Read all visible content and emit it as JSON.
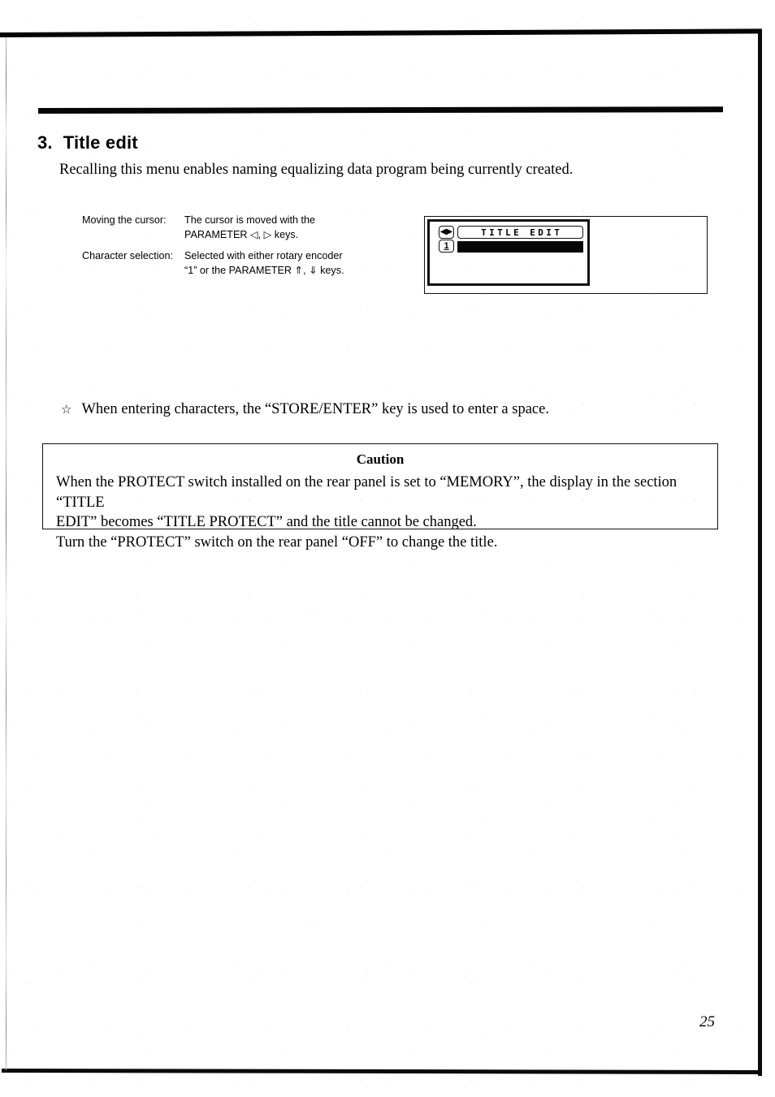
{
  "section": {
    "number": "3.",
    "title": "Title edit",
    "lead": "Recalling this menu enables naming equalizing data program being currently created."
  },
  "instructions": [
    {
      "label": "Moving the cursor:",
      "lines": [
        "The cursor is moved with the",
        "PARAMETER ◁, ▷ keys."
      ]
    },
    {
      "label": "Character selection:",
      "lines": [
        "Selected with either rotary encoder",
        "“1” or the PARAMETER ⇑, ⇓ keys."
      ]
    }
  ],
  "lcd_figure": {
    "title_text": "TITLE EDIT",
    "cursor_badge": "◀▶",
    "encoder_badge": "1",
    "entry_field_value": ""
  },
  "note": {
    "bullet": "☆",
    "text": "When entering characters, the “STORE/ENTER” key is used to enter a space."
  },
  "caution": {
    "title": "Caution",
    "lines": [
      "When the PROTECT switch installed on the rear panel is set to “MEMORY”, the display in the section “TITLE",
      "EDIT” becomes “TITLE PROTECT” and the title cannot be changed.",
      "Turn the “PROTECT” switch on the rear panel “OFF” to change the title."
    ]
  },
  "page_number": "25"
}
